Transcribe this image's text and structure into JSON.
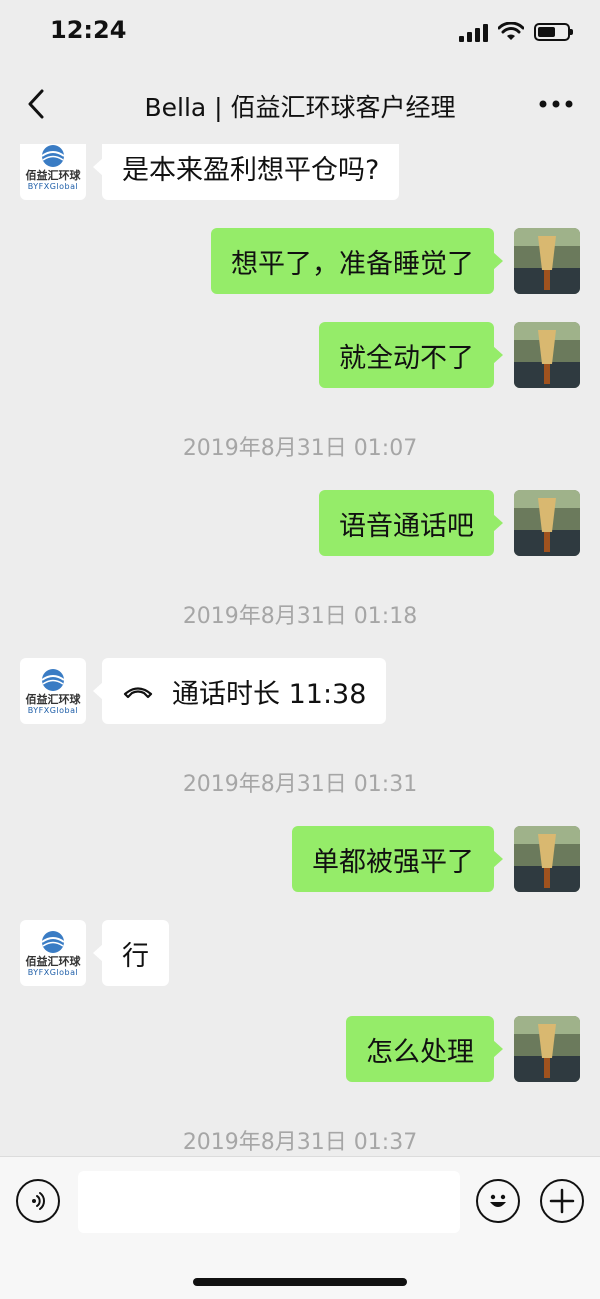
{
  "status_bar": {
    "time": "12:24",
    "signal_icon": "signal-bars-icon",
    "wifi_icon": "wifi-icon",
    "battery_icon": "battery-icon",
    "battery_level": 0.6
  },
  "nav": {
    "title": "Bella | 佰益汇环球客户经理",
    "back_icon": "chevron-left-icon",
    "more_icon": "more-dots-icon"
  },
  "contact": {
    "logo_text": "佰益汇环球",
    "logo_sub": "BYFXGlobal"
  },
  "messages": [
    {
      "type": "text",
      "from": "them",
      "text": "是本来盈利想平仓吗?"
    },
    {
      "type": "text",
      "from": "me",
      "text": "想平了，准备睡觉了"
    },
    {
      "type": "text",
      "from": "me",
      "text": "就全动不了"
    },
    {
      "type": "time",
      "text": "2019年8月31日 01:07"
    },
    {
      "type": "text",
      "from": "me",
      "text": "语音通话吧"
    },
    {
      "type": "time",
      "text": "2019年8月31日 01:18"
    },
    {
      "type": "call",
      "from": "them",
      "text": "通话时长 11:38",
      "icon": "phone-handset-icon"
    },
    {
      "type": "time",
      "text": "2019年8月31日 01:31"
    },
    {
      "type": "text",
      "from": "me",
      "text": "单都被强平了"
    },
    {
      "type": "text",
      "from": "them",
      "text": "行"
    },
    {
      "type": "text",
      "from": "me",
      "text": "怎么处理"
    },
    {
      "type": "time",
      "text": "2019年8月31日 01:37"
    }
  ],
  "input_bar": {
    "voice_icon": "voice-icon",
    "input_value": "",
    "emoji_icon": "emoji-icon",
    "plus_icon": "plus-icon"
  },
  "colors": {
    "background": "#ededed",
    "my_bubble": "#95ec69",
    "their_bubble": "#ffffff",
    "timestamp": "#a6a6a6"
  }
}
